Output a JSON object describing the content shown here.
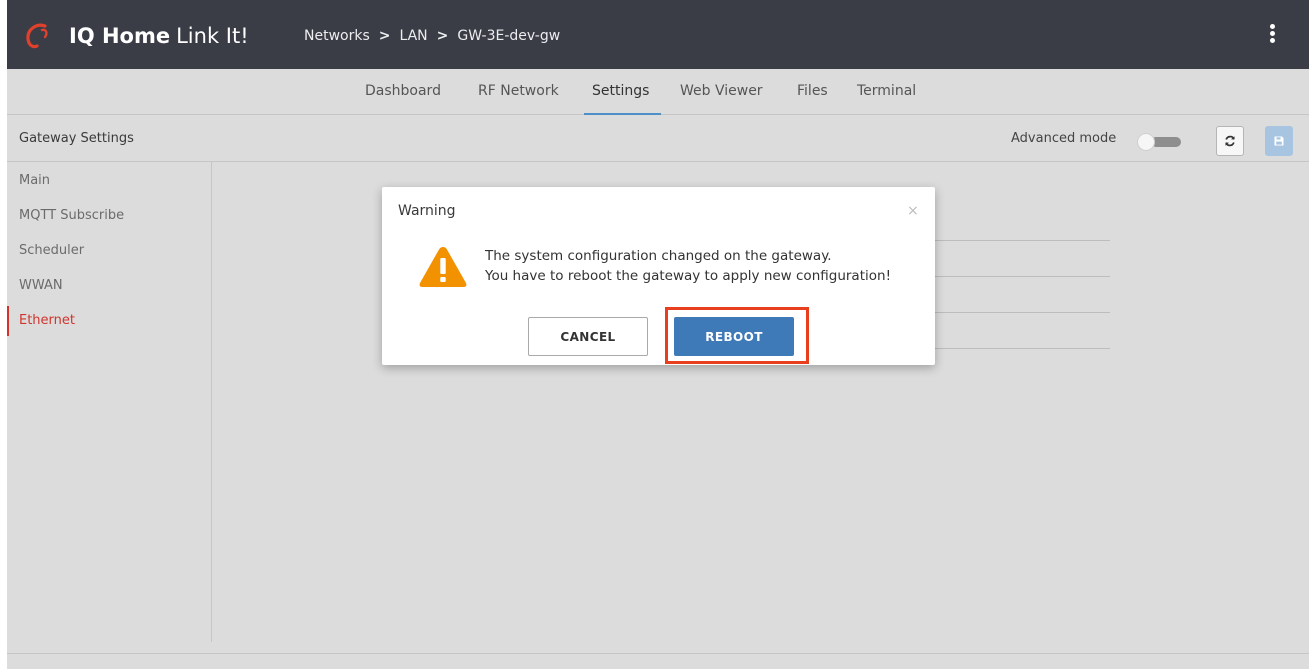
{
  "app": {
    "brand_bold": "IQ Home",
    "brand_light": "Link It!",
    "colors": {
      "topbar": "#3a3d46",
      "accent_red": "#d0342c",
      "primary_blue": "#3e7ab8",
      "warning_orange": "#f39200",
      "highlight": "#e8401f"
    }
  },
  "breadcrumb": {
    "items": [
      "Networks",
      "LAN",
      "GW-3E-dev-gw"
    ],
    "separator": ">"
  },
  "tabs": [
    {
      "label": "Dashboard",
      "active": false
    },
    {
      "label": "RF Network",
      "active": false
    },
    {
      "label": "Settings",
      "active": true
    },
    {
      "label": "Web Viewer",
      "active": false
    },
    {
      "label": "Files",
      "active": false
    },
    {
      "label": "Terminal",
      "active": false
    }
  ],
  "settings_header": {
    "title": "Gateway Settings",
    "advanced_mode_label": "Advanced mode",
    "advanced_mode_on": false
  },
  "sidebar": {
    "items": [
      {
        "label": "Main",
        "active": false
      },
      {
        "label": "MQTT Subscribe",
        "active": false
      },
      {
        "label": "Scheduler",
        "active": false
      },
      {
        "label": "WWAN",
        "active": false
      },
      {
        "label": "Ethernet",
        "active": true
      }
    ]
  },
  "modal": {
    "title": "Warning",
    "close_symbol": "×",
    "message_line1": "The system configuration changed on the gateway.",
    "message_line2": "You have to reboot the gateway to apply new configuration!",
    "cancel_label": "CANCEL",
    "reboot_label": "REBOOT"
  }
}
